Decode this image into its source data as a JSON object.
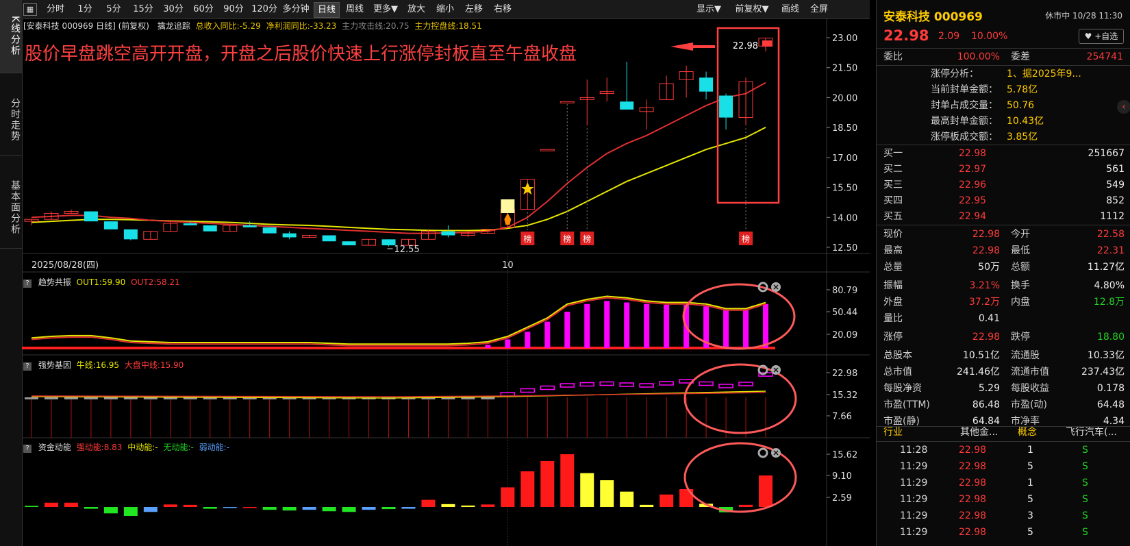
{
  "sidebar": [
    "K线分析",
    "分时走势",
    "基本面分析"
  ],
  "toolbar": {
    "left": [
      "分时",
      "1分",
      "5分",
      "15分",
      "30分",
      "60分",
      "90分",
      "120分",
      "多分钟",
      "日线",
      "周线",
      "更多▼",
      "放大",
      "缩小",
      "左移",
      "右移"
    ],
    "active": "日线",
    "right": [
      "显示▼",
      "前复权▼",
      "画线",
      "全屏"
    ]
  },
  "main": {
    "info": {
      "title": "[安泰科技 000969 日线] (前复权)",
      "indicator": "擒龙追踪",
      "rev": "总收入同比:-5.29",
      "profit": "净利润同比:-33.23",
      "attack": "主力攻击线:20.75",
      "control": "主力控盘线:18.51"
    },
    "annotation": "股价早盘跳空高开开盘，开盘之后股价快速上行涨停封板直至午盘收盘",
    "price_labels": [
      "23.00",
      "21.50",
      "20.00",
      "18.50",
      "17.00",
      "15.50",
      "14.00",
      "12.50"
    ],
    "last_price": "22.98",
    "low_label": "12.55",
    "date_label": "2025/08/28(四)",
    "month_label": "10",
    "bang": "榜"
  },
  "panel1": {
    "name": "趋势共振",
    "out1": "OUT1:59.90",
    "out2": "OUT2:58.21",
    "axis": [
      "80.79",
      "50.44",
      "20.09"
    ]
  },
  "panel2": {
    "name": "强势基因",
    "bull": "牛线:16.95",
    "market": "大盘中线:15.90",
    "axis": [
      "22.98",
      "15.32",
      "7.66"
    ]
  },
  "panel3": {
    "name": "资金动能",
    "strong": "强动能:8.83",
    "mid": "中动能:-",
    "none": "无动能:-",
    "weak": "弱动能:-",
    "axis": [
      "15.62",
      "9.10",
      "2.59"
    ]
  },
  "chart_data": {
    "type": "candlestick",
    "candles": [
      [
        13.8,
        13.9,
        13.6,
        13.9
      ],
      [
        13.9,
        14.3,
        13.9,
        14.2
      ],
      [
        14.2,
        14.4,
        14.2,
        14.3
      ],
      [
        14.3,
        14.3,
        13.8,
        13.8
      ],
      [
        13.8,
        13.8,
        13.4,
        13.4
      ],
      [
        13.4,
        13.4,
        12.85,
        12.9
      ],
      [
        12.9,
        13.3,
        12.9,
        13.3
      ],
      [
        13.3,
        13.8,
        13.3,
        13.7
      ],
      [
        13.7,
        13.8,
        13.6,
        13.6
      ],
      [
        13.6,
        13.6,
        13.3,
        13.3
      ],
      [
        13.3,
        13.6,
        13.3,
        13.6
      ],
      [
        13.6,
        13.8,
        13.5,
        13.5
      ],
      [
        13.5,
        13.5,
        13.2,
        13.2
      ],
      [
        13.2,
        13.3,
        12.9,
        13.0
      ],
      [
        13.0,
        13.1,
        13.0,
        13.1
      ],
      [
        13.1,
        13.1,
        12.8,
        12.8
      ],
      [
        12.8,
        12.8,
        12.6,
        12.6
      ],
      [
        12.6,
        12.9,
        12.6,
        12.9
      ],
      [
        12.9,
        12.9,
        12.55,
        12.6
      ],
      [
        12.6,
        12.9,
        12.6,
        12.9
      ],
      [
        12.9,
        13.4,
        12.9,
        13.3
      ],
      [
        13.3,
        13.6,
        13.0,
        13.1
      ],
      [
        13.1,
        13.3,
        13.0,
        13.2
      ],
      [
        13.2,
        13.4,
        13.2,
        13.4
      ],
      [
        13.5,
        14.4,
        13.5,
        14.4
      ],
      [
        14.4,
        15.9,
        14.4,
        15.9
      ],
      [
        17.4,
        17.4,
        17.4,
        17.4
      ],
      [
        19.8,
        19.8,
        19.8,
        19.8
      ],
      [
        19.9,
        20.9,
        18.6,
        20.0
      ],
      [
        20.2,
        21.0,
        19.8,
        20.3
      ],
      [
        19.8,
        21.8,
        19.8,
        19.4
      ],
      [
        19.3,
        19.9,
        18.4,
        19.5
      ],
      [
        19.9,
        21.1,
        19.9,
        20.7
      ],
      [
        20.9,
        21.6,
        20.0,
        21.3
      ],
      [
        21.0,
        21.3,
        19.9,
        20.3
      ],
      [
        20.1,
        20.2,
        18.4,
        19.0
      ],
      [
        19.0,
        21.0,
        18.6,
        20.8
      ],
      [
        22.58,
        22.98,
        22.31,
        22.98
      ]
    ],
    "ma_fast": [
      14.0,
      14.05,
      14.1,
      14.1,
      14.0,
      13.95,
      13.85,
      13.8,
      13.75,
      13.7,
      13.65,
      13.6,
      13.55,
      13.5,
      13.45,
      13.4,
      13.35,
      13.3,
      13.25,
      13.2,
      13.2,
      13.22,
      13.25,
      13.3,
      13.5,
      14.0,
      14.8,
      15.7,
      16.5,
      17.2,
      17.7,
      18.1,
      18.6,
      19.1,
      19.6,
      20.0,
      20.2,
      20.75
    ],
    "ma_slow": [
      13.75,
      13.8,
      13.85,
      13.9,
      13.9,
      13.88,
      13.85,
      13.82,
      13.8,
      13.78,
      13.75,
      13.7,
      13.65,
      13.62,
      13.6,
      13.55,
      13.5,
      13.45,
      13.4,
      13.38,
      13.35,
      13.34,
      13.34,
      13.36,
      13.45,
      13.6,
      13.9,
      14.3,
      14.8,
      15.3,
      15.8,
      16.2,
      16.6,
      17.0,
      17.4,
      17.7,
      18.0,
      18.51
    ],
    "panel1_bars": [
      0,
      0,
      0,
      0,
      0,
      0,
      0,
      0,
      0,
      0,
      0,
      0,
      0,
      0,
      0,
      0,
      0,
      0,
      0,
      0,
      0,
      0,
      0,
      5,
      12,
      22,
      35,
      48,
      58,
      62,
      60,
      58,
      57,
      57,
      55,
      50,
      50,
      58
    ],
    "panel1_out1": [
      14,
      16,
      17,
      17,
      14,
      10,
      9,
      8,
      8,
      8,
      8,
      8,
      8,
      8,
      8,
      7,
      6,
      6,
      6,
      6,
      6,
      6,
      7,
      9,
      16,
      28,
      40,
      58,
      64,
      68,
      66,
      62,
      60,
      60,
      58,
      52,
      52,
      59.9
    ],
    "panel2_pink": [
      0,
      0,
      0,
      0,
      0,
      0,
      0,
      0,
      0,
      0,
      0,
      0,
      0,
      0,
      0,
      0,
      0,
      0,
      0,
      0,
      0,
      0,
      0,
      0,
      17.2,
      18.3,
      19.1,
      19.8,
      20.1,
      20.3,
      20.0,
      19.8,
      20.4,
      21.0,
      20.3,
      19.6,
      20.2,
      22.98
    ],
    "panel3_bars": [
      0.3,
      1.2,
      1.2,
      -0.5,
      -1.8,
      -2.5,
      -1.4,
      0.7,
      0.6,
      -0.5,
      -0.3,
      -0.3,
      -0.8,
      -1.0,
      -0.8,
      -1.2,
      -1.4,
      -0.8,
      -0.6,
      -0.5,
      2.0,
      0.8,
      0.4,
      0.7,
      5.5,
      10.0,
      12.9,
      14.8,
      9.5,
      7.5,
      4.3,
      0.6,
      3.5,
      5.0,
      0.9,
      -1.5,
      0.6,
      8.83
    ],
    "panel3_colors": [
      "g",
      "r",
      "r",
      "g",
      "g",
      "g",
      "b",
      "r",
      "r",
      "g",
      "b",
      "r",
      "g",
      "g",
      "b",
      "g",
      "g",
      "b",
      "g",
      "b",
      "r",
      "y",
      "y",
      "r",
      "r",
      "r",
      "r",
      "r",
      "y",
      "y",
      "y",
      "y",
      "r",
      "r",
      "y",
      "g",
      "r",
      "r"
    ]
  },
  "quote": {
    "name": "安泰科技 000969",
    "status": "休市中 10/28 11:30",
    "price": "22.98",
    "change": "2.09",
    "pct": "10.00%",
    "fav": "♥ +自选",
    "webi_label": "委比",
    "webi": "100.00%",
    "weicha_label": "委差",
    "weicha": "254741",
    "limit_analysis": [
      [
        "涨停分析：",
        "1、据2025年9..."
      ],
      [
        "当前封单金额：",
        "5.78亿"
      ],
      [
        "封单占成交量：",
        "50.76"
      ],
      [
        "最高封单金额：",
        "10.43亿"
      ],
      [
        "涨停板成交额：",
        "3.85亿"
      ]
    ],
    "bids": [
      [
        "买一",
        "22.98",
        "251667"
      ],
      [
        "买二",
        "22.97",
        "561"
      ],
      [
        "买三",
        "22.96",
        "549"
      ],
      [
        "买四",
        "22.95",
        "852"
      ],
      [
        "买五",
        "22.94",
        "1112"
      ]
    ],
    "stats": [
      [
        "现价",
        "22.98",
        "r",
        "今开",
        "22.58",
        "r"
      ],
      [
        "最高",
        "22.98",
        "r",
        "最低",
        "22.31",
        "r"
      ],
      [
        "总量",
        "50万",
        "w",
        "总额",
        "11.27亿",
        "w"
      ],
      [
        "振幅",
        "3.21%",
        "r",
        "换手",
        "4.80%",
        "w"
      ],
      [
        "外盘",
        "37.2万",
        "r",
        "内盘",
        "12.8万",
        "g"
      ],
      [
        "量比",
        "0.41",
        "w",
        "",
        "",
        ""
      ],
      [
        "涨停",
        "22.98",
        "r",
        "跌停",
        "18.80",
        "g"
      ],
      [
        "总股本",
        "10.51亿",
        "w",
        "流通股",
        "10.33亿",
        "w"
      ],
      [
        "总市值",
        "241.46亿",
        "w",
        "流通市值",
        "237.43亿",
        "w"
      ],
      [
        "每股净资",
        "5.29",
        "w",
        "每股收益",
        "0.178",
        "w"
      ],
      [
        "市盈(TTM)",
        "86.48",
        "w",
        "市盈(动)",
        "64.48",
        "w"
      ],
      [
        "市盈(静)",
        "64.84",
        "w",
        "市净率",
        "4.34",
        "w"
      ]
    ],
    "industry_label": "行业",
    "industry": "其他金...",
    "concept_label": "概念",
    "concept": "飞行汽车(...",
    "ticks": [
      [
        "11:28",
        "22.98",
        "1",
        "S"
      ],
      [
        "11:29",
        "22.98",
        "5",
        "S"
      ],
      [
        "11:29",
        "22.98",
        "1",
        "S"
      ],
      [
        "11:29",
        "22.98",
        "5",
        "S"
      ],
      [
        "11:29",
        "22.98",
        "3",
        "S"
      ],
      [
        "11:29",
        "22.98",
        "5",
        "S"
      ]
    ]
  }
}
